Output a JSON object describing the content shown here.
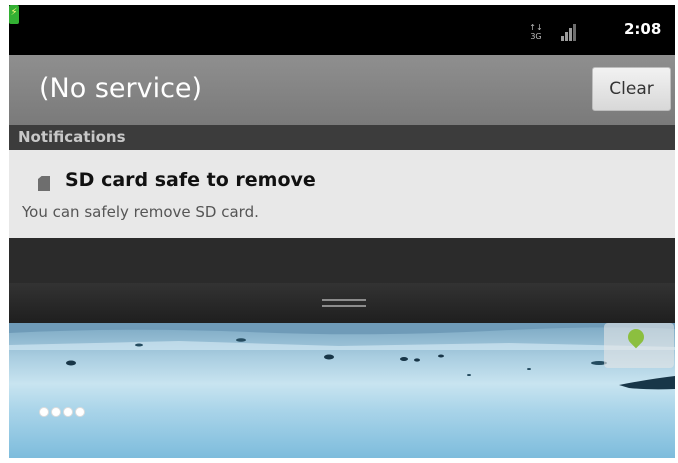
{
  "status_bar": {
    "network_icon": "3g-data-icon",
    "signal_icon": "signal-strength-icon",
    "battery_icon": "battery-charging-icon",
    "time": "2:08"
  },
  "carrier": {
    "title": "(No service)",
    "clear_label": "Clear"
  },
  "notifications": {
    "section_title": "Notifications",
    "items": [
      {
        "icon": "sd-card-icon",
        "title": "SD card safe to remove",
        "body": "You can safely remove SD card."
      }
    ]
  },
  "home": {
    "drag_handle_icon": "drag-handle-icon",
    "dock_icon": "android-market-icon",
    "page_dots_count": 4
  },
  "colors": {
    "status_bar": "#000000",
    "carrier_bar": "#858585",
    "section_header": "#3c3c3c",
    "notification_bg": "#e8e8e8",
    "battery": "#33b033"
  }
}
